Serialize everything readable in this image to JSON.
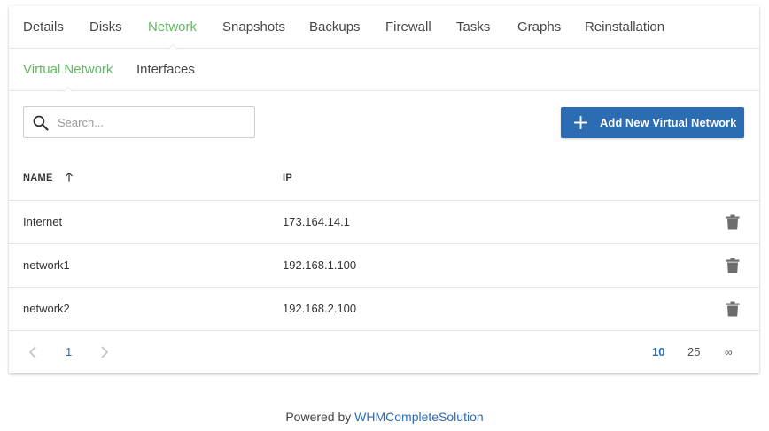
{
  "tabs": [
    {
      "label": "Details"
    },
    {
      "label": "Disks"
    },
    {
      "label": "Network",
      "active": true
    },
    {
      "label": "Snapshots"
    },
    {
      "label": "Backups"
    },
    {
      "label": "Firewall"
    },
    {
      "label": "Tasks"
    },
    {
      "label": "Graphs"
    },
    {
      "label": "Reinstallation"
    }
  ],
  "subtabs": [
    {
      "label": "Virtual Network",
      "active": true
    },
    {
      "label": "Interfaces"
    }
  ],
  "search": {
    "placeholder": "Search...",
    "value": ""
  },
  "add_button": {
    "label": "Add New Virtual Network"
  },
  "table": {
    "columns": {
      "name": "NAME",
      "ip": "IP"
    },
    "sort": {
      "column": "name",
      "direction": "ascending"
    },
    "rows": [
      {
        "name": "Internet",
        "ip": "173.164.14.1"
      },
      {
        "name": "network1",
        "ip": "192.168.1.100"
      },
      {
        "name": "network2",
        "ip": "192.168.2.100"
      }
    ]
  },
  "pagination": {
    "current_page": "1",
    "page_sizes": [
      "10",
      "25",
      "∞"
    ],
    "selected_page_size": "10"
  },
  "footer": {
    "prefix": "Powered by",
    "link": "WHMCompleteSolution"
  },
  "colors": {
    "accent_green": "#63b963",
    "primary_blue": "#2b6cb3",
    "border": "#e5e5e5",
    "icon_gray": "#6d6d6d"
  },
  "icons": {
    "search": "search-icon",
    "add": "plus-icon",
    "sort": "arrow-up-icon",
    "delete": "trash-icon",
    "prev": "chevron-left-icon",
    "next": "chevron-right-icon"
  }
}
